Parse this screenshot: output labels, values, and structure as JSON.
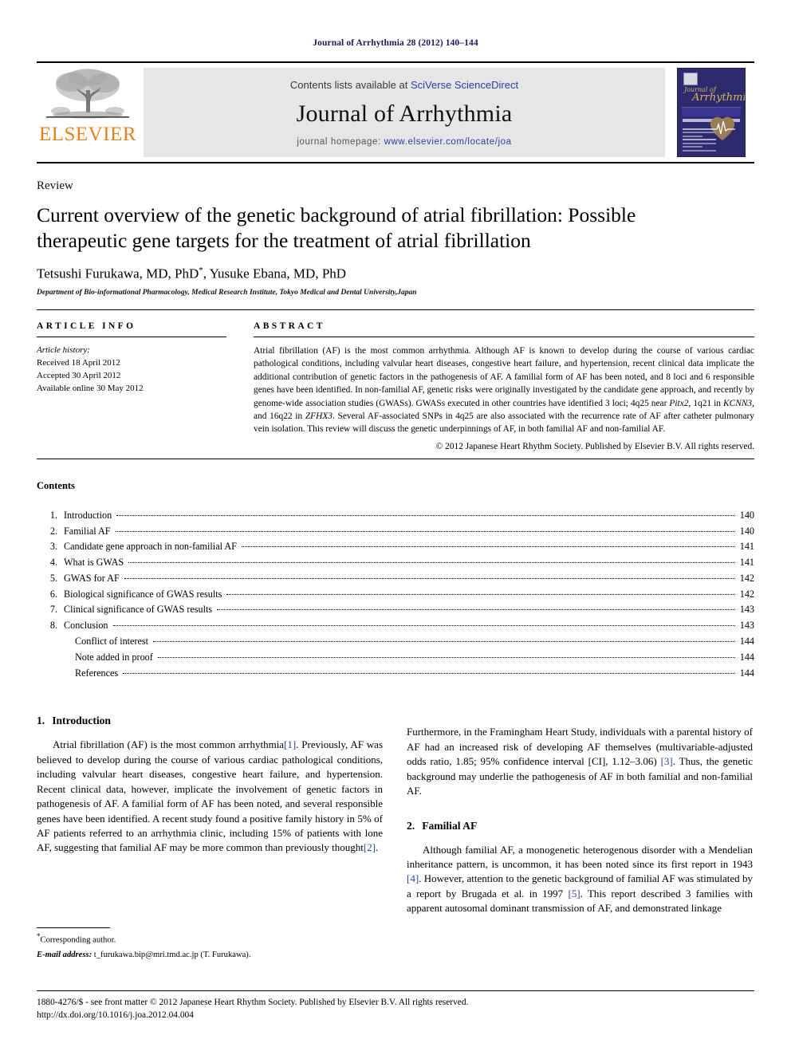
{
  "running_head": "Journal of Arrhythmia 28 (2012) 140–144",
  "masthead": {
    "publisher_name": "ELSEVIER",
    "contents_prefix": "Contents lists available at ",
    "contents_link": "SciVerse ScienceDirect",
    "journal_title": "Journal of Arrhythmia",
    "homepage_prefix": "journal homepage: ",
    "homepage_url": "www.elsevier.com/locate/joa",
    "cover": {
      "script_small": "Journal of",
      "script_big": "Arrhythmia"
    },
    "colors": {
      "elsevier_orange": "#F07F13",
      "link_blue": "#2b3faa",
      "panel_gray": "#e6e6e6",
      "cover_navy": "#2d2a6e",
      "cover_gold": "#d9b45a"
    }
  },
  "article": {
    "doctype": "Review",
    "title": "Current overview of the genetic background of atrial fibrillation: Possible therapeutic gene targets for the treatment of atrial fibrillation",
    "authors": "Tetsushi Furukawa, MD, PhD",
    "authors_marker": "*",
    "authors_rest": ", Yusuke Ebana, MD, PhD",
    "affiliation": "Department of Bio-informational Pharmacology, Medical Research Institute, Tokyo Medical and Dental University,Japan"
  },
  "info": {
    "heading": "ARTICLE INFO",
    "history_label": "Article history:",
    "received": "Received 18 April 2012",
    "accepted": "Accepted 30 April 2012",
    "available": "Available online 30 May 2012"
  },
  "abstract": {
    "heading": "ABSTRACT",
    "p1": "Atrial fibrillation (AF) is the most common arrhythmia. Although AF is known to develop during the course of various cardiac pathological conditions, including valvular heart diseases, congestive heart failure, and hypertension, recent clinical data implicate the additional contribution of genetic factors in the pathogenesis of AF. A familial form of AF has been noted, and 8 loci and 6 responsible genes have been identified. In non-familial AF, genetic risks were originally investigated by the candidate gene approach, and recently by genome-wide association studies (GWASs). GWASs executed in other countries have identified 3 loci; 4q25 near ",
    "gene1": "Pitx2",
    "p2": ", 1q21 in ",
    "gene2": "KCNN3",
    "p3": ", and 16q22 in ",
    "gene3": "ZFHX3",
    "p4": ". Several AF-associated SNPs in 4q25 are also associated with the recurrence rate of AF after catheter pulmonary vein isolation. This review will discuss the genetic underpinnings of AF, in both familial AF and non-familial AF.",
    "copyright": "© 2012 Japanese Heart Rhythm Society. Published by Elsevier B.V. All rights reserved."
  },
  "contents": {
    "heading": "Contents",
    "entries": [
      {
        "num": "1.",
        "label": "Introduction",
        "page": "140"
      },
      {
        "num": "2.",
        "label": "Familial AF",
        "page": "140"
      },
      {
        "num": "3.",
        "label": "Candidate gene approach in non-familial AF",
        "page": "141"
      },
      {
        "num": "4.",
        "label": "What is GWAS",
        "page": "141"
      },
      {
        "num": "5.",
        "label": "GWAS for AF",
        "page": "142"
      },
      {
        "num": "6.",
        "label": "Biological significance of GWAS results",
        "page": "142"
      },
      {
        "num": "7.",
        "label": "Clinical significance of GWAS results",
        "page": "143"
      },
      {
        "num": "8.",
        "label": "Conclusion",
        "page": "143"
      },
      {
        "num": "",
        "label": "Conflict of interest",
        "page": "144",
        "sub": true
      },
      {
        "num": "",
        "label": "Note added in proof",
        "page": "144",
        "sub": true
      },
      {
        "num": "",
        "label": "References",
        "page": "144",
        "sub": true
      }
    ]
  },
  "body": {
    "s1_heading_num": "1.",
    "s1_heading": "Introduction",
    "s1_p1_a": "Atrial fibrillation (AF) is the most common arrhythmia",
    "s1_p1_cite1": "[1]",
    "s1_p1_b": ". Previously, AF was believed to develop during the course of various cardiac pathological conditions, including valvular heart diseases, congestive heart failure, and hypertension. Recent clinical data, however, implicate the involvement of genetic factors in pathogenesis of AF. A familial form of AF has been noted, and several responsible genes have been identified. A recent study found a positive family history in 5% of AF patients referred to an arrhythmia clinic, including 15% of patients with lone AF, suggesting that familial AF may be more common than previously thought",
    "s1_p1_cite2": "[2]",
    "s1_p1_c": ".",
    "r_p1_a": "Furthermore, in the Framingham Heart Study, individuals with a parental history of AF had an increased risk of developing AF themselves (multivariable-adjusted odds ratio, 1.85; 95% confidence interval [CI], 1.12–3.06) ",
    "r_p1_cite": "[3]",
    "r_p1_b": ". Thus, the genetic background may underlie the pathogenesis of AF in both familial and non-familial AF.",
    "s2_heading_num": "2.",
    "s2_heading": "Familial AF",
    "s2_p1_a": "Although familial AF, a monogenetic heterogenous disorder with a Mendelian inheritance pattern, is uncommon, it has been noted since its first report in 1943 ",
    "s2_p1_cite1": "[4]",
    "s2_p1_b": ". However, attention to the genetic background of familial AF was stimulated by a report by Brugada et al. in 1997 ",
    "s2_p1_cite2": "[5]",
    "s2_p1_c": ". This report described 3 families with apparent autosomal dominant transmission of AF, and demonstrated linkage"
  },
  "footnote": {
    "corresponding": "Corresponding author.",
    "email_label": "E-mail address:",
    "email": " t_furukawa.bip@mri.tmd.ac.jp (T. Furukawa)."
  },
  "footer": {
    "line1": "1880-4276/$ - see front matter © 2012 Japanese Heart Rhythm Society. Published by Elsevier B.V. All rights reserved.",
    "line2": "http://dx.doi.org/10.1016/j.joa.2012.04.004"
  }
}
